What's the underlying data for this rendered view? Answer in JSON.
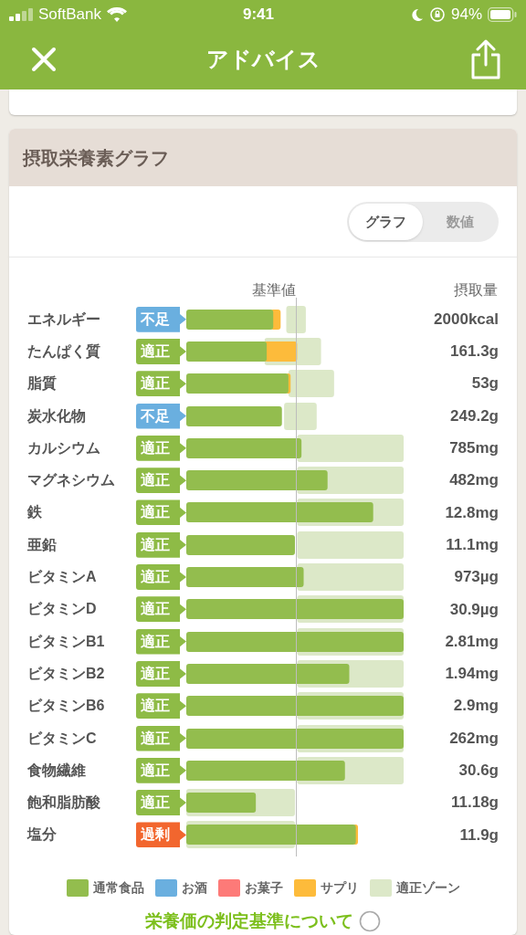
{
  "status_bar": {
    "carrier": "SoftBank",
    "time": "9:41",
    "battery": "94%"
  },
  "nav": {
    "title": "アドバイス"
  },
  "card": {
    "title": "摂取栄養素グラフ",
    "toggle": [
      {
        "label": "グラフ",
        "selected": true
      },
      {
        "label": "数値",
        "selected": false
      }
    ],
    "columns": {
      "reference": "基準値",
      "intake": "摂取量"
    },
    "rows": [
      {
        "name": "エネルギー",
        "status": {
          "kind": "low",
          "label": "不足"
        },
        "amount": "2000kcal"
      },
      {
        "name": "たんぱく質",
        "status": {
          "kind": "ok",
          "label": "適正"
        },
        "amount": "161.3g"
      },
      {
        "name": "脂質",
        "status": {
          "kind": "ok",
          "label": "適正"
        },
        "amount": "53g"
      },
      {
        "name": "炭水化物",
        "status": {
          "kind": "low",
          "label": "不足"
        },
        "amount": "249.2g"
      },
      {
        "name": "カルシウム",
        "status": {
          "kind": "ok",
          "label": "適正"
        },
        "amount": "785mg"
      },
      {
        "name": "マグネシウム",
        "status": {
          "kind": "ok",
          "label": "適正"
        },
        "amount": "482mg"
      },
      {
        "name": "鉄",
        "status": {
          "kind": "ok",
          "label": "適正"
        },
        "amount": "12.8mg"
      },
      {
        "name": "亜鉛",
        "status": {
          "kind": "ok",
          "label": "適正"
        },
        "amount": "11.1mg"
      },
      {
        "name": "ビタミンA",
        "status": {
          "kind": "ok",
          "label": "適正"
        },
        "amount": "973µg"
      },
      {
        "name": "ビタミンD",
        "status": {
          "kind": "ok",
          "label": "適正"
        },
        "amount": "30.9µg"
      },
      {
        "name": "ビタミンB1",
        "status": {
          "kind": "ok",
          "label": "適正"
        },
        "amount": "2.81mg"
      },
      {
        "name": "ビタミンB2",
        "status": {
          "kind": "ok",
          "label": "適正"
        },
        "amount": "1.94mg"
      },
      {
        "name": "ビタミンB6",
        "status": {
          "kind": "ok",
          "label": "適正"
        },
        "amount": "2.9mg"
      },
      {
        "name": "ビタミンC",
        "status": {
          "kind": "ok",
          "label": "適正"
        },
        "amount": "262mg"
      },
      {
        "name": "食物繊維",
        "status": {
          "kind": "ok",
          "label": "適正"
        },
        "amount": "30.6g"
      },
      {
        "name": "飽和脂肪酸",
        "status": {
          "kind": "ok",
          "label": "適正"
        },
        "amount": "11.18g"
      },
      {
        "name": "塩分",
        "status": {
          "kind": "high",
          "label": "過剰"
        },
        "amount": "11.9g"
      }
    ],
    "legend": [
      {
        "label": "通常食品",
        "color": "#93bd4e"
      },
      {
        "label": "お酒",
        "color": "#6aafdf"
      },
      {
        "label": "お菓子",
        "color": "#fd7a78"
      },
      {
        "label": "サプリ",
        "color": "#fdbb3b"
      },
      {
        "label": "適正ゾーン",
        "color": "#dce8c8"
      }
    ],
    "link": "栄養価の判定基準について"
  }
}
